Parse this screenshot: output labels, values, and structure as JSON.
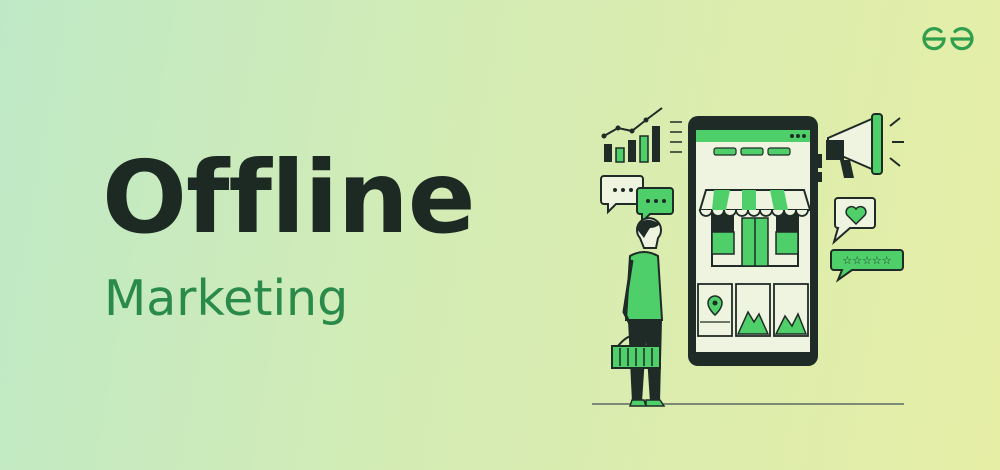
{
  "banner": {
    "title": "Offline",
    "subtitle": "Marketing",
    "brand_icon": "gfg-logo-icon",
    "colors": {
      "title": "#1d2a24",
      "subtitle": "#2a8a49",
      "accent": "#4fcf6a",
      "dark": "#1f2b26"
    }
  }
}
